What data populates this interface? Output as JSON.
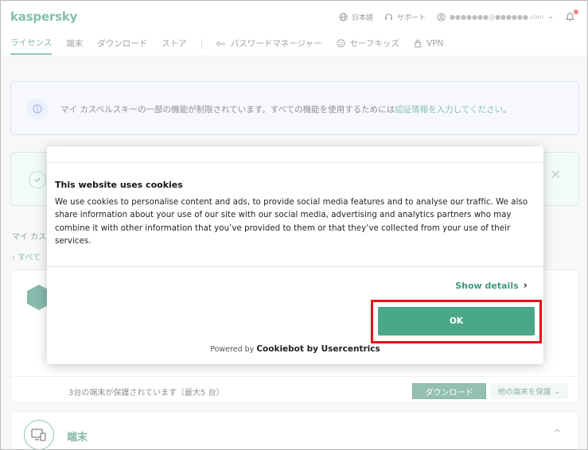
{
  "header": {
    "logo": "kaspersky",
    "language": "日本語",
    "support": "サポート",
    "account_email": "●●●●●●●@●●●●●●.com",
    "tabs": [
      {
        "label": "ライセンス"
      },
      {
        "label": "端末"
      },
      {
        "label": "ダウンロード"
      },
      {
        "label": "ストア"
      },
      {
        "label": "パスワードマネージャー"
      },
      {
        "label": "セーフキッズ"
      },
      {
        "label": "VPN"
      }
    ]
  },
  "info_banner": {
    "text": "マイ カスペルスキーの一部の機能が制限されています。すべての機能を使用するためには",
    "link": "認証情報を入力してください",
    "suffix": "。"
  },
  "breadcrumb": "マイ カス",
  "back": "すべて",
  "license_card": {
    "protected_text": "3台の端末が保護されています（最大5 台）",
    "download_button": "ダウンロード",
    "protect_other_button": "他の端末を保護"
  },
  "devices_card": {
    "title": "端末"
  },
  "cookie_dialog": {
    "title": "This website uses cookies",
    "body": "We use cookies to personalise content and ads, to provide social media features and to analyse our traffic. We also share information about your use of our site with our social media, advertising and analytics partners who may combine it with other information that you’ve provided to them or that they’ve collected from your use of their services.",
    "show_details": "Show details",
    "ok_button": "OK",
    "powered_prefix": "Powered by",
    "powered_brand": "Cookiebot by Usercentrics"
  },
  "colors": {
    "accent": "#2e9e7e",
    "ok_button": "#4aa888",
    "highlight": "#e0141a",
    "notification_dot": "#e0242a"
  }
}
